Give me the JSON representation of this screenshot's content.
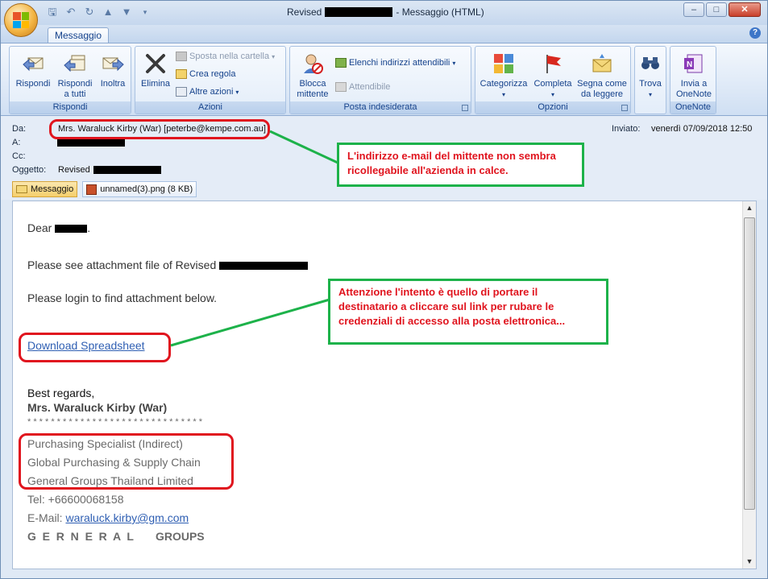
{
  "window": {
    "title_prefix": "Revised",
    "title_suffix": "- Messaggio (HTML)",
    "min": "–",
    "max": "□",
    "close": "✕"
  },
  "ribbon": {
    "tab": "Messaggio",
    "groups": {
      "rispondi": {
        "label": "Rispondi",
        "reply": "Rispondi",
        "reply_all_1": "Rispondi",
        "reply_all_2": "a tutti",
        "forward": "Inoltra"
      },
      "azioni": {
        "label": "Azioni",
        "delete": "Elimina",
        "move": "Sposta nella cartella",
        "rule": "Crea regola",
        "other": "Altre azioni"
      },
      "posta": {
        "label": "Posta indesiderata",
        "block_1": "Blocca",
        "block_2": "mittente",
        "safe_lists": "Elenchi indirizzi attendibili",
        "trusted": "Attendibile"
      },
      "opzioni": {
        "label": "Opzioni",
        "categorize": "Categorizza",
        "followup": "Completa",
        "unread_1": "Segna come",
        "unread_2": "da leggere"
      },
      "trova": {
        "find": "Trova"
      },
      "onenote": {
        "label": "OneNote",
        "send_1": "Invia a",
        "send_2": "OneNote"
      }
    }
  },
  "header": {
    "from_label": "Da:",
    "from_value": "Mrs. Waraluck Kirby (War) [peterbe@kempe.com.au]",
    "to_label": "A:",
    "cc_label": "Cc:",
    "subject_label": "Oggetto:",
    "subject_value": "Revised",
    "sent_label": "Inviato:",
    "sent_value": "venerdì 07/09/2018 12:50"
  },
  "attachments": {
    "message": "Messaggio",
    "file": "unnamed(3).png (8 KB)"
  },
  "body": {
    "greeting": "Dear",
    "line1": "Please see attachment file of Revised",
    "line2": "Please login to find attachment below.",
    "link": "Download Spreadsheet",
    "regards": "Best regards,",
    "name": "Mrs. Waraluck Kirby (War)",
    "stars": "* * * * * * * * * * * * * * * * * * * * * * * * * * * * * *",
    "role": "Purchasing Specialist (Indirect)",
    "dept": "Global Purchasing & Supply Chain",
    "company": "General Groups Thailand Limited",
    "tel": "Tel: +66600068158",
    "email_label": "E-Mail:",
    "email": "waraluck.kirby@gm.com",
    "footer": "G  E  R  N  E  R  A  L       GROUPS"
  },
  "annotations": {
    "callout1": "L'indirizzo e-mail del mittente non sembra ricollegabile all'azienda in calce.",
    "callout2": "Attenzione l'intento è quello di portare il destinatario a cliccare sul link per rubare le credenziali di accesso alla posta elettronica...",
    "colors": {
      "callout_border": "#1db24a",
      "callout_text": "#e0141e",
      "highlight": "#e0141e"
    }
  }
}
